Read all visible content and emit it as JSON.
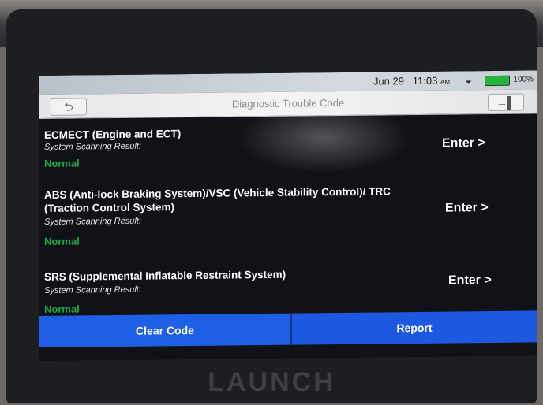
{
  "status_bar": {
    "date": "Jun 29",
    "time": "11:03",
    "ampm": "AM",
    "battery": "100%",
    "battery_color": "#24b33b"
  },
  "header": {
    "title": "Diagnostic Trouble Code",
    "back_icon": "back-arrow-icon",
    "exit_icon": "exit-icon"
  },
  "systems": [
    {
      "name": "ECMECT (Engine and ECT)",
      "result_label": "System Scanning Result:",
      "result": "Normal",
      "enter": "Enter >"
    },
    {
      "name": "ABS (Anti-lock Braking System)/VSC (Vehicle Stability Control)/ TRC (Traction Control System)",
      "result_label": "System Scanning Result:",
      "result": "Normal",
      "enter": "Enter >"
    },
    {
      "name": "SRS (Supplemental Inflatable Restraint System)",
      "result_label": "System Scanning Result:",
      "result": "Normal",
      "enter": "Enter >"
    }
  ],
  "footer": {
    "clear_code": "Clear Code",
    "report": "Report",
    "accent_color": "#1f5fe6"
  },
  "device": {
    "brand": "LAUNCH"
  }
}
